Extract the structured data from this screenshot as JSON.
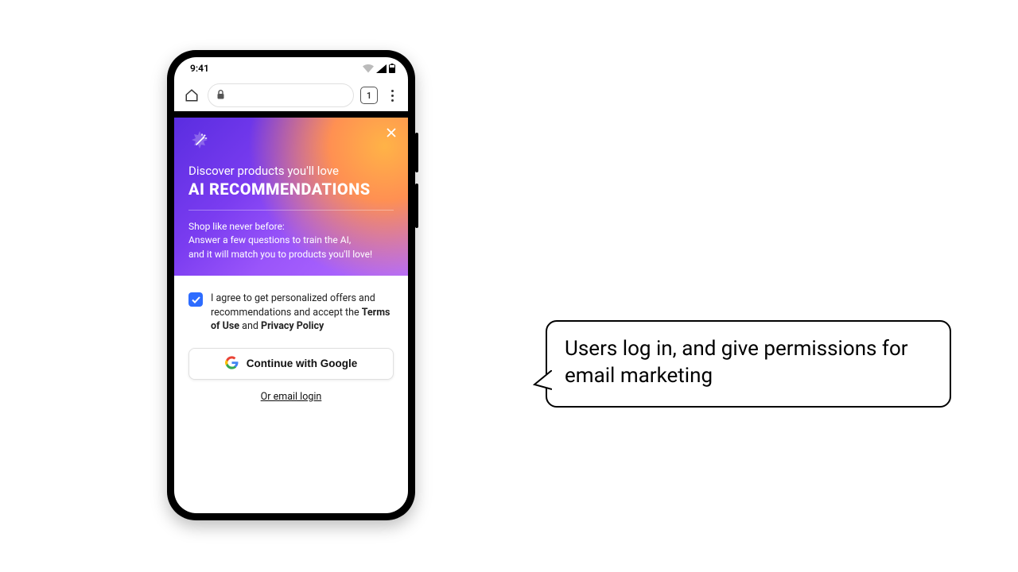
{
  "status": {
    "time": "9:41",
    "tab_count": "1"
  },
  "hero": {
    "subtitle": "Discover products you'll love",
    "title": "AI RECOMMENDATIONS",
    "body_l1": "Shop like never before:",
    "body_l2": "Answer a few questions to train the AI,",
    "body_l3": "and it will match you to products you'll love!"
  },
  "consent": {
    "pre": "I agree to get personalized offers and recommendations and accept the ",
    "terms": "Terms of Use",
    "and": " and ",
    "privacy": "Privacy Policy"
  },
  "auth": {
    "google_label": "Continue with Google",
    "email_label": "Or email login"
  },
  "annotation": {
    "text": "Users log in, and give permissions for email marketing"
  }
}
